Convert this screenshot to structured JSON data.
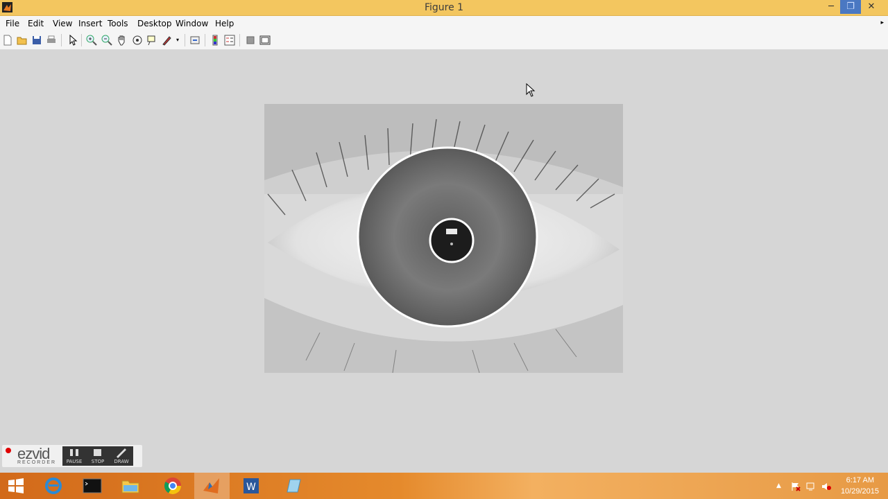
{
  "window": {
    "title": "Figure 1",
    "controls": {
      "minimize": "─",
      "maximize": "❐",
      "close": "✕"
    }
  },
  "menu": {
    "items": [
      "File",
      "Edit",
      "View",
      "Insert",
      "Tools",
      "Desktop",
      "Window",
      "Help"
    ],
    "collapse_glyph": "▸"
  },
  "toolbar": {
    "buttons": [
      "new-figure",
      "open-file",
      "save-figure",
      "print-figure",
      "edit-plot",
      "zoom-in",
      "zoom-out",
      "pan",
      "rotate-3d",
      "data-cursor",
      "brush",
      "link-plot",
      "insert-colorbar",
      "insert-legend",
      "hide-plot-tools",
      "show-plot-tools"
    ]
  },
  "figure": {
    "image": "grayscale eye with detected iris and pupil circles"
  },
  "ezvid": {
    "brand": "ezvid",
    "sub": "RECORDER",
    "buttons": {
      "pause": "PAUSE",
      "stop": "STOP",
      "draw": "DRAW"
    }
  },
  "taskbar": {
    "apps": [
      "windows-start",
      "internet-explorer",
      "command-prompt",
      "file-explorer",
      "chrome",
      "matlab",
      "word",
      "other-app"
    ],
    "active_app": "matlab",
    "time": "6:17 AM",
    "date": "10/29/2015"
  },
  "colors": {
    "titlebar": "#f3c65f",
    "figure_bg": "#d6d6d6",
    "taskbar": "#e58a2c"
  }
}
